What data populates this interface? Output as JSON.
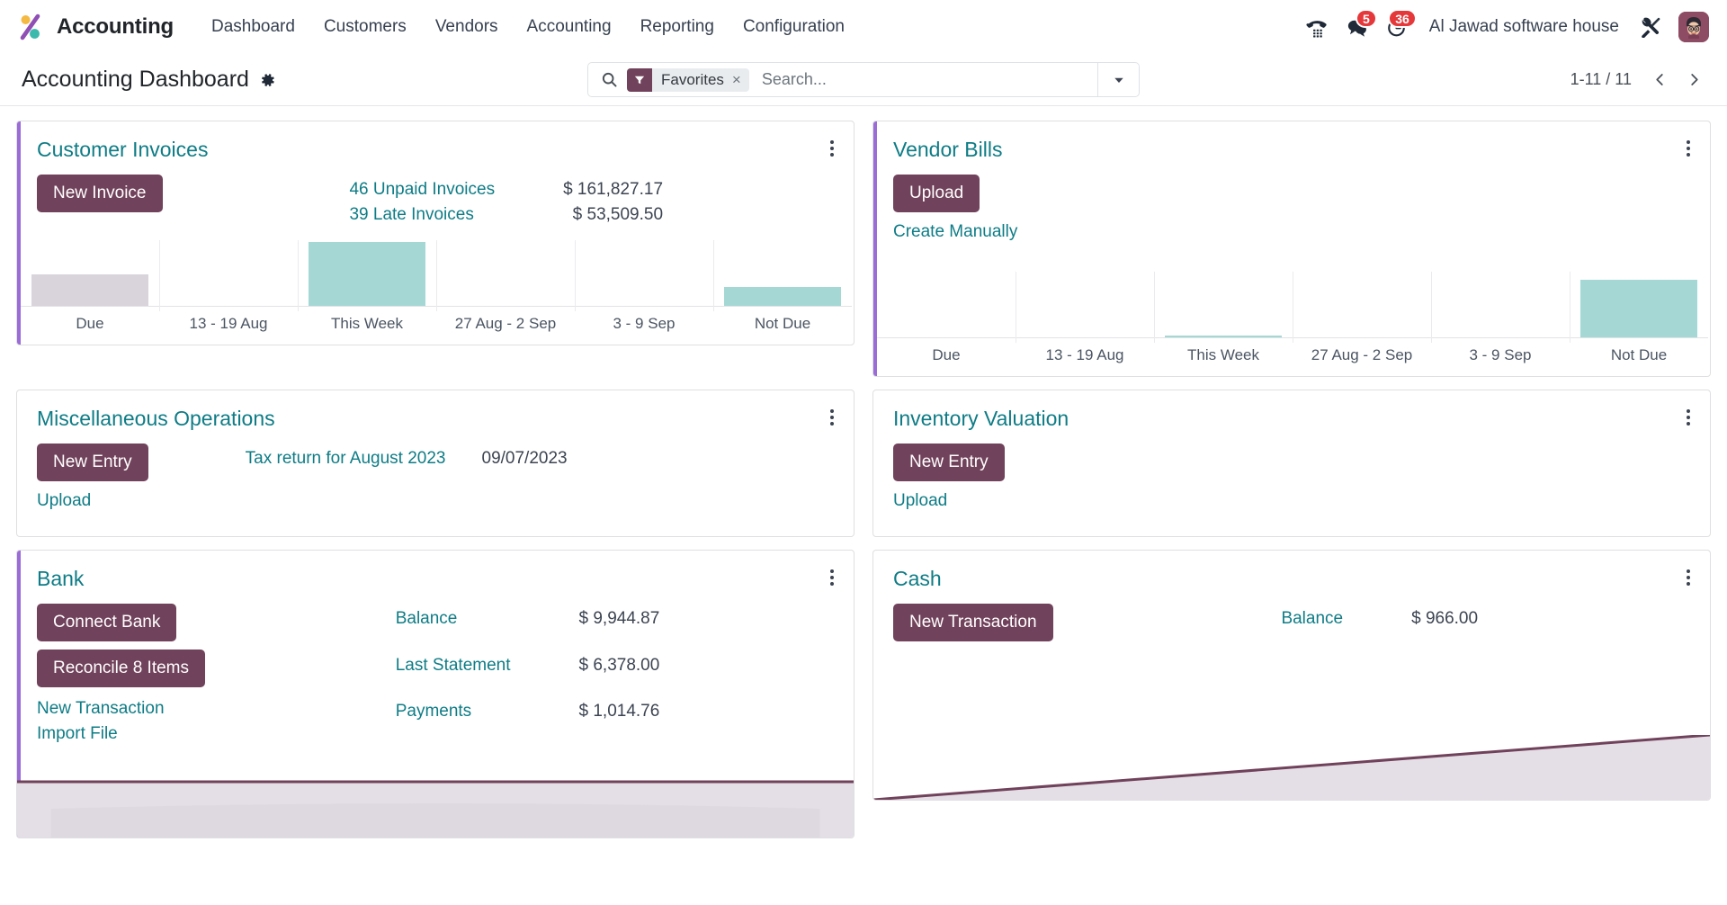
{
  "navbar": {
    "brand": "Accounting",
    "menu": [
      "Dashboard",
      "Customers",
      "Vendors",
      "Accounting",
      "Reporting",
      "Configuration"
    ],
    "voip_icon": "phone-keypad-icon",
    "messages_icon": "chat-bubbles-icon",
    "messages_count": "5",
    "activities_icon": "clock-icon",
    "activities_count": "36",
    "company": "Al Jawad software house",
    "tools_icon": "wrench-screwdriver-icon",
    "avatar": "user-avatar"
  },
  "control_panel": {
    "title": "Accounting Dashboard",
    "gear_icon": "gear-icon",
    "search_icon": "search-icon",
    "facet": {
      "icon": "filter-funnel-icon",
      "label": "Favorites",
      "remove": "×"
    },
    "search_placeholder": "Search...",
    "search_value": "",
    "dropdown_icon": "caret-down-icon",
    "pager": {
      "value": "1-11 / 11",
      "prev_icon": "chevron-left-icon",
      "next_icon": "chevron-right-icon"
    }
  },
  "cards": {
    "customer_invoices": {
      "title": "Customer Invoices",
      "kebab_icon": "kebab-menu-icon",
      "primary_button": "New Invoice",
      "figures": [
        {
          "label": "46 Unpaid Invoices",
          "value": "$ 161,827.17"
        },
        {
          "label": "39 Late Invoices",
          "value": "$ 53,509.50"
        }
      ]
    },
    "vendor_bills": {
      "title": "Vendor Bills",
      "kebab_icon": "kebab-menu-icon",
      "primary_button": "Upload",
      "secondary_link": "Create Manually"
    },
    "misc_operations": {
      "title": "Miscellaneous Operations",
      "kebab_icon": "kebab-menu-icon",
      "primary_button": "New Entry",
      "secondary_link": "Upload",
      "entry_label": "Tax return for August 2023",
      "entry_date": "09/07/2023"
    },
    "inventory_valuation": {
      "title": "Inventory Valuation",
      "kebab_icon": "kebab-menu-icon",
      "primary_button": "New Entry",
      "secondary_link": "Upload"
    },
    "bank": {
      "title": "Bank",
      "kebab_icon": "kebab-menu-icon",
      "primary_button": "Connect Bank",
      "secondary_button": "Reconcile 8 Items",
      "links": [
        "New Transaction",
        "Import File"
      ],
      "figures": [
        {
          "label": "Balance",
          "value": "$ 9,944.87"
        },
        {
          "label": "Last Statement",
          "value": "$ 6,378.00"
        },
        {
          "label": "Payments",
          "value": "$ 1,014.76"
        }
      ]
    },
    "cash": {
      "title": "Cash",
      "kebab_icon": "kebab-menu-icon",
      "primary_button": "New Transaction",
      "figures": [
        {
          "label": "Balance",
          "value": "$ 966.00"
        }
      ]
    }
  },
  "colors": {
    "accent_purple": "#9b6bd8",
    "brand_button": "#71425b",
    "title_teal": "#0e7c86",
    "bar_teal": "#a5d8d5",
    "bar_gray": "#d9d4db",
    "badge_red": "#e5383b"
  },
  "chart_data": [
    {
      "type": "bar",
      "title": "Customer Invoices",
      "categories": [
        "Due",
        "13 - 19 Aug",
        "This Week",
        "27 Aug - 2 Sep",
        "3 - 9 Sep",
        "Not Due"
      ],
      "values": [
        46,
        0,
        74,
        0,
        0,
        27
      ],
      "colors": [
        "#d9d4db",
        "#a5d8d5",
        "#a5d8d5",
        "#a5d8d5",
        "#a5d8d5",
        "#a5d8d5"
      ],
      "xlabel": "",
      "ylabel": "",
      "ylim": [
        0,
        74
      ],
      "grid": true,
      "legend": "none"
    },
    {
      "type": "bar",
      "title": "Vendor Bills",
      "categories": [
        "Due",
        "13 - 19 Aug",
        "This Week",
        "27 Aug - 2 Sep",
        "3 - 9 Sep",
        "Not Due"
      ],
      "values": [
        0,
        0,
        3,
        0,
        0,
        66
      ],
      "colors": [
        "#a5d8d5",
        "#a5d8d5",
        "#a5d8d5",
        "#a5d8d5",
        "#a5d8d5",
        "#a5d8d5"
      ],
      "xlabel": "",
      "ylabel": "",
      "ylim": [
        0,
        74
      ],
      "grid": true,
      "legend": "none"
    },
    {
      "type": "area",
      "title": "Bank balance trend",
      "x": [
        0,
        1,
        2,
        3,
        4,
        5,
        6
      ],
      "values": [
        50,
        50,
        50,
        50,
        50,
        50,
        50
      ],
      "line_color": "#71425b",
      "fill_color": "#e4dfe6",
      "ylim": [
        0,
        100
      ]
    },
    {
      "type": "area",
      "title": "Cash balance trend",
      "x": [
        0,
        1,
        2,
        3,
        4,
        5,
        6
      ],
      "values": [
        0,
        12,
        26,
        40,
        56,
        72,
        92
      ],
      "line_color": "#71425b",
      "fill_color": "#e4dfe6",
      "ylim": [
        0,
        100
      ]
    }
  ]
}
